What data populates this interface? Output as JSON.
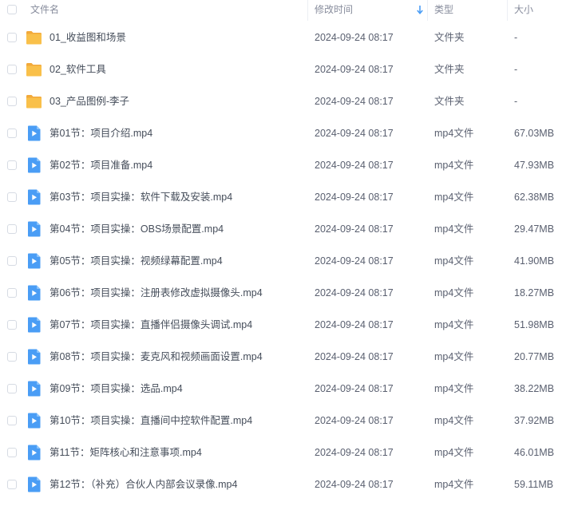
{
  "header": {
    "name": "文件名",
    "modified": "修改时间",
    "type": "类型",
    "size": "大小",
    "sort_icon": "arrow-down-icon"
  },
  "colors": {
    "folder": "#f9c04a",
    "folder_back": "#f2a93b",
    "video": "#4a9df5",
    "border": "#d6dbe3"
  },
  "rows": [
    {
      "icon": "folder-icon",
      "name": "01_收益图和场景",
      "time": "2024-09-24 08:17",
      "type": "文件夹",
      "size": "-"
    },
    {
      "icon": "folder-icon",
      "name": "02_软件工具",
      "time": "2024-09-24 08:17",
      "type": "文件夹",
      "size": "-"
    },
    {
      "icon": "folder-icon",
      "name": "03_产品图例-李子",
      "time": "2024-09-24 08:17",
      "type": "文件夹",
      "size": "-"
    },
    {
      "icon": "video-file-icon",
      "name": "第01节：项目介绍.mp4",
      "time": "2024-09-24 08:17",
      "type": "mp4文件",
      "size": "67.03MB"
    },
    {
      "icon": "video-file-icon",
      "name": "第02节：项目准备.mp4",
      "time": "2024-09-24 08:17",
      "type": "mp4文件",
      "size": "47.93MB"
    },
    {
      "icon": "video-file-icon",
      "name": "第03节：项目实操：软件下载及安装.mp4",
      "time": "2024-09-24 08:17",
      "type": "mp4文件",
      "size": "62.38MB"
    },
    {
      "icon": "video-file-icon",
      "name": "第04节：项目实操：OBS场景配置.mp4",
      "time": "2024-09-24 08:17",
      "type": "mp4文件",
      "size": "29.47MB"
    },
    {
      "icon": "video-file-icon",
      "name": "第05节：项目实操：视频绿幕配置.mp4",
      "time": "2024-09-24 08:17",
      "type": "mp4文件",
      "size": "41.90MB"
    },
    {
      "icon": "video-file-icon",
      "name": "第06节：项目实操：注册表修改虚拟摄像头.mp4",
      "time": "2024-09-24 08:17",
      "type": "mp4文件",
      "size": "18.27MB"
    },
    {
      "icon": "video-file-icon",
      "name": "第07节：项目实操：直播伴侣摄像头调试.mp4",
      "time": "2024-09-24 08:17",
      "type": "mp4文件",
      "size": "51.98MB"
    },
    {
      "icon": "video-file-icon",
      "name": "第08节：项目实操：麦克风和视频画面设置.mp4",
      "time": "2024-09-24 08:17",
      "type": "mp4文件",
      "size": "20.77MB"
    },
    {
      "icon": "video-file-icon",
      "name": "第09节：项目实操：选品.mp4",
      "time": "2024-09-24 08:17",
      "type": "mp4文件",
      "size": "38.22MB"
    },
    {
      "icon": "video-file-icon",
      "name": "第10节：项目实操：直播间中控软件配置.mp4",
      "time": "2024-09-24 08:17",
      "type": "mp4文件",
      "size": "37.92MB"
    },
    {
      "icon": "video-file-icon",
      "name": "第11节：矩阵核心和注意事项.mp4",
      "time": "2024-09-24 08:17",
      "type": "mp4文件",
      "size": "46.01MB"
    },
    {
      "icon": "video-file-icon",
      "name": "第12节：（补充）合伙人内部会议录像.mp4",
      "time": "2024-09-24 08:17",
      "type": "mp4文件",
      "size": "59.11MB"
    }
  ]
}
